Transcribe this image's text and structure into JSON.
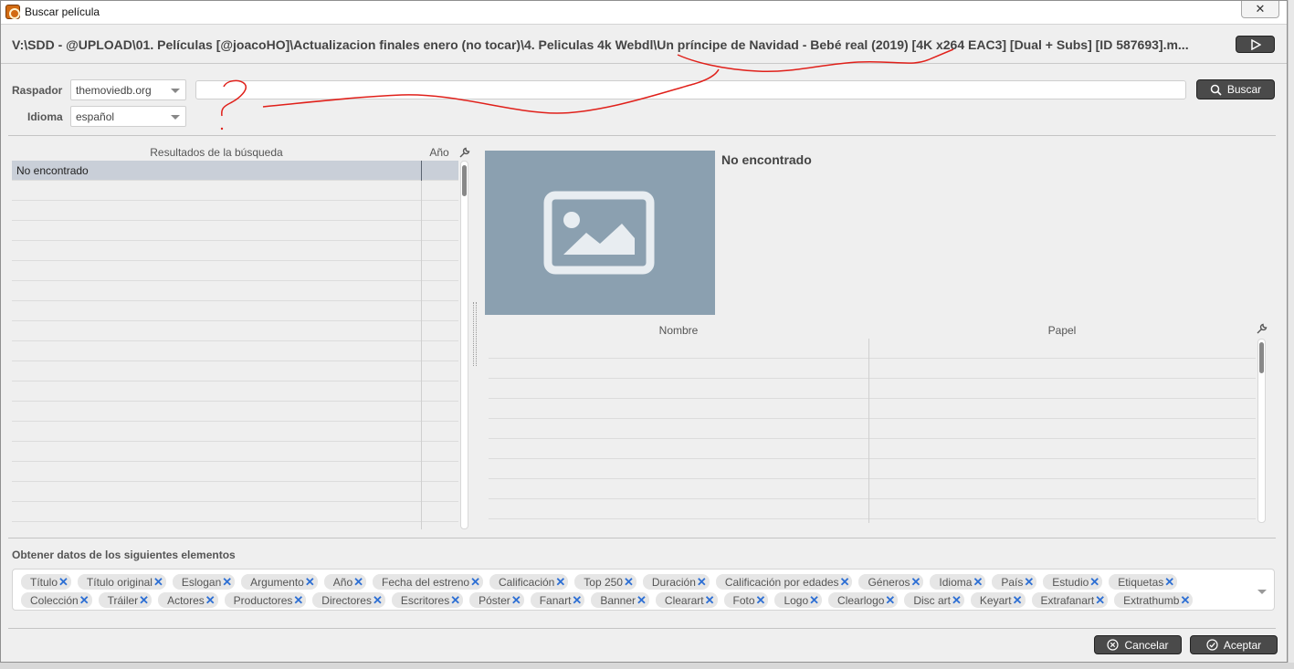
{
  "window": {
    "title": "Buscar pelí­cula",
    "close_glyph": "✕"
  },
  "path": {
    "text": "V:\\SDD - @UPLOAD\\01. Películas [@joacoHO]\\Actualizacion finales enero (no tocar)\\4. Peliculas 4k Webdl\\Un príncipe de Navidad - Bebé real (2019) [4K x264 EAC3] [Dual + Subs] [ID 587693].m..."
  },
  "search": {
    "scraper_label": "Raspador",
    "scraper_value": "themoviedb.org",
    "language_label": "Idioma",
    "language_value": "español",
    "query_value": "",
    "button_label": "Buscar"
  },
  "results": {
    "col_title": "Resultados de la búsqueda",
    "col_year": "Año",
    "rows": [
      {
        "title": "No encontrado",
        "year": ""
      }
    ]
  },
  "detail": {
    "title": "No encontrado",
    "cast_col_name": "Nombre",
    "cast_col_role": "Papel"
  },
  "elements": {
    "title": "Obtener datos de los siguientes elementos",
    "tags": [
      "Tí­tulo",
      "Tí­tulo original",
      "Eslogan",
      "Argumento",
      "Año",
      "Fecha del estreno",
      "Calificación",
      "Top 250",
      "Duración",
      "Calificación por edades",
      "Géneros",
      "Idioma",
      "País",
      "Estudio",
      "Etiquetas",
      "Colección",
      "Tráiler",
      "Actores",
      "Productores",
      "Directores",
      "Escritores",
      "Póster",
      "Fanart",
      "Banner",
      "Clearart",
      "Foto",
      "Logo",
      "Clearlogo",
      "Disc art",
      "Keyart",
      "Extrafanart",
      "Extrathumb"
    ]
  },
  "footer": {
    "cancel_label": "Cancelar",
    "accept_label": "Aceptar"
  },
  "colors": {
    "dark_button": "#4a4a4a",
    "tag_remove": "#2d6fd4",
    "poster_bg": "#8ba0b0",
    "annotation": "#e0201a"
  }
}
